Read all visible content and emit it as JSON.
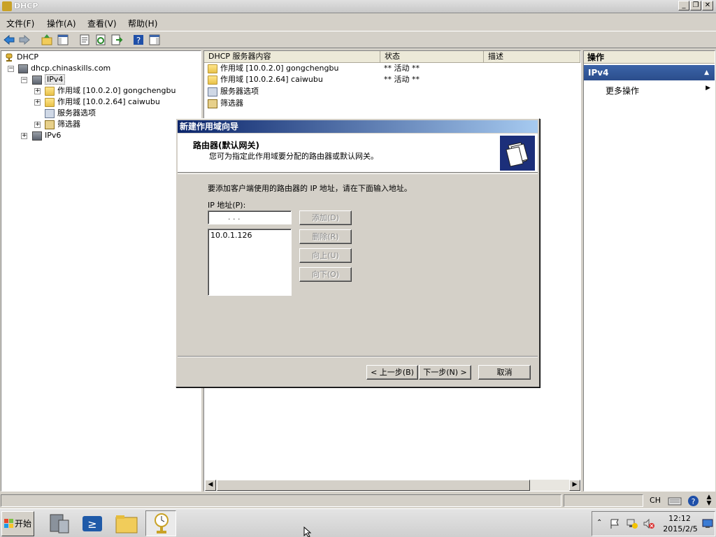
{
  "window": {
    "title": "DHCP"
  },
  "menu": [
    "文件(F)",
    "操作(A)",
    "查看(V)",
    "帮助(H)"
  ],
  "tree": {
    "root": "DHCP",
    "server": "dhcp.chinaskills.com",
    "ipv4": "IPv4",
    "scope1": "作用域 [10.0.2.0] gongchengbu",
    "scope2": "作用域 [10.0.2.64] caiwubu",
    "server_options": "服务器选项",
    "filters": "筛选器",
    "ipv6": "IPv6"
  },
  "content": {
    "columns": [
      "DHCP 服务器内容",
      "状态",
      "描述"
    ],
    "rows": [
      {
        "name": "作用域 [10.0.2.0] gongchengbu",
        "status": "** 活动 **"
      },
      {
        "name": "作用域 [10.0.2.64] caiwubu",
        "status": "** 活动 **"
      },
      {
        "name": "服务器选项",
        "status": ""
      },
      {
        "name": "筛选器",
        "status": ""
      }
    ]
  },
  "actions": {
    "header": "操作",
    "section": "IPv4",
    "more": "更多操作"
  },
  "dialog": {
    "title": "新建作用域向导",
    "heading": "路由器(默认网关)",
    "subheading": "您可为指定此作用域要分配的路由器或默认网关。",
    "instruction": "要添加客户端使用的路由器的 IP 地址，请在下面输入地址。",
    "ip_label": "IP 地址(P):",
    "ip_placeholder": ".     .     .",
    "list": [
      "10.0.1.126"
    ],
    "add": "添加(D)",
    "remove": "删除(R)",
    "up": "向上(U)",
    "down": "向下(O)",
    "back": "< 上一步(B)",
    "next": "下一步(N) >",
    "cancel": "取消"
  },
  "taskbar": {
    "start": "开始",
    "lang": "CH",
    "time": "12:12",
    "date": "2015/2/5"
  }
}
